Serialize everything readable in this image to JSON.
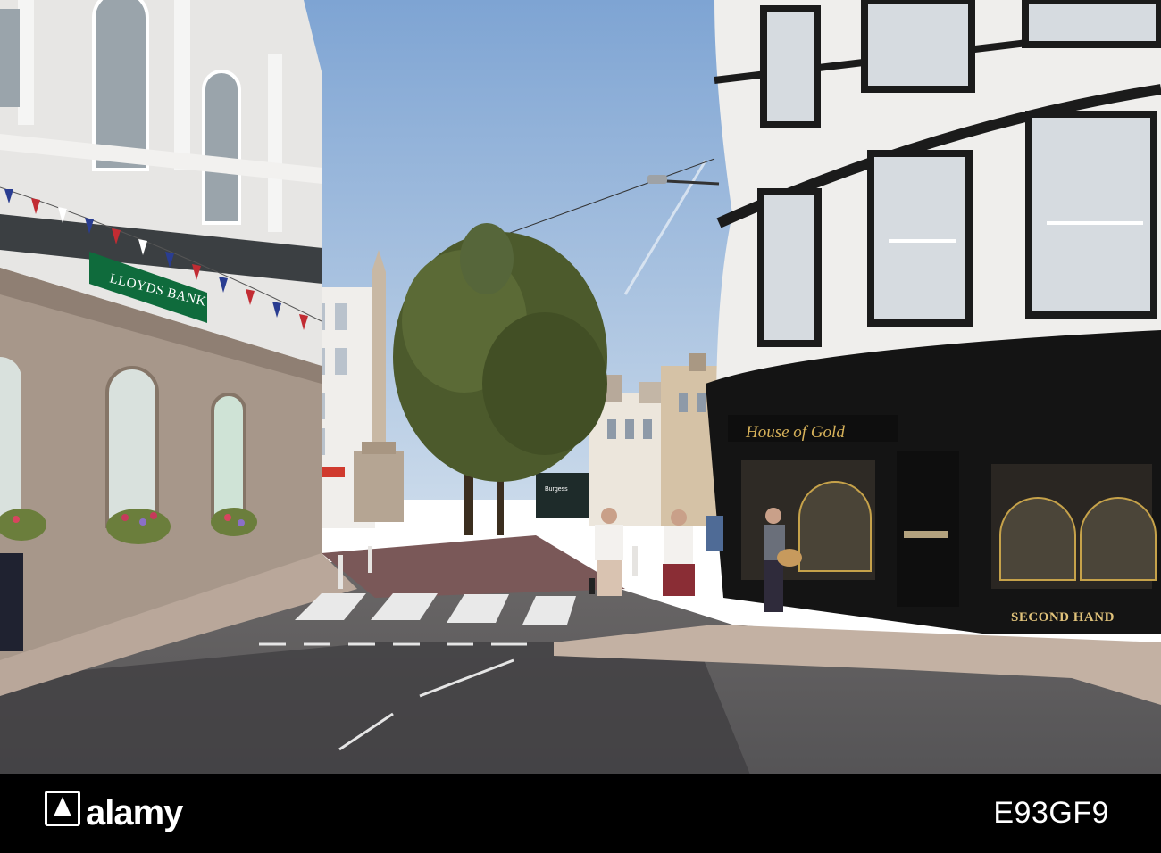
{
  "photo": {
    "signs": {
      "bank": "LLOYDS BANK",
      "jeweller": "House of Gold",
      "second_hand": "SECOND HAND"
    }
  },
  "footer": {
    "logo_text": "alamy",
    "image_id": "E93GF9"
  },
  "colors": {
    "sky": "#9db9dc",
    "bank_green": "#0f6b3c",
    "shopfront_black": "#141414",
    "stone": "#a7978a",
    "tree": "#4c5a2c",
    "road": "#4b4b4d"
  }
}
